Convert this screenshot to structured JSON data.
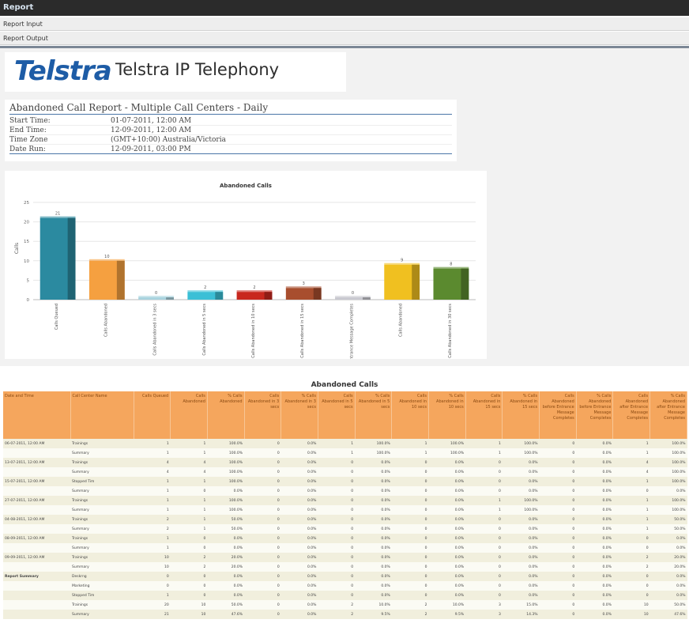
{
  "app": {
    "title": "Report"
  },
  "menu": {
    "items": [
      "Report Input",
      "Report Output"
    ]
  },
  "logo": {
    "wordmark": "Telstra",
    "product": "Telstra IP Telephony"
  },
  "report": {
    "title": "Abandoned Call Report - Multiple Call Centers - Daily",
    "fields": [
      {
        "label": "Start Time:",
        "value": "01-07-2011, 12:00 AM"
      },
      {
        "label": "End Time:",
        "value": "12-09-2011, 12:00 AM"
      },
      {
        "label": "Time Zone",
        "value": "(GMT+10:00) Australia/Victoria"
      },
      {
        "label": "Date Run:",
        "value": "12-09-2011, 03:00 PM"
      }
    ]
  },
  "chart_data": {
    "type": "bar",
    "title": "Abandoned Calls",
    "ylabel": "Calls",
    "ylim": [
      0,
      25
    ],
    "yticks": [
      0,
      5,
      10,
      15,
      20,
      25
    ],
    "grid": true,
    "categories": [
      "Calls Queued",
      "Calls Abandoned",
      "Calls Abandoned in 3 secs",
      "Calls Abandoned in 5 secs",
      "Calls Abandoned in 10 secs",
      "Calls Abandoned in 15 secs",
      "Calls Abandoned before Entrance Message Completes",
      "Calls Abandoned",
      "Calls Abandoned in 30 secs"
    ],
    "values": [
      21,
      10,
      0,
      2,
      2,
      3,
      0,
      9,
      8
    ],
    "colors": [
      "#2b8aa0",
      "#f5a040",
      "#a9d3de",
      "#3bbfd6",
      "#c8281e",
      "#a84e2e",
      "#c9c9d0",
      "#f0c020",
      "#5b8a2f"
    ]
  },
  "table": {
    "title": "Abandoned Calls",
    "columns": [
      "Date and Time",
      "Call Center Name",
      "Calls Queued",
      "Calls Abandoned",
      "% Calls Abandoned",
      "Calls Abandoned in 3 secs",
      "% Calls Abandoned in 3 secs",
      "Calls Abandoned in 5 secs",
      "% Calls Abandoned in 5 secs",
      "Calls Abandoned in 10 secs",
      "% Calls Abandoned in 10 secs",
      "Calls Abandoned in 15 secs",
      "% Calls Abandoned in 15 secs",
      "Calls Abandoned before Entrance Message Completes",
      "% Calls Abandoned before Entrance Message Completes",
      "Calls Abandoned after Entrance Message Completes",
      "% Calls Abandoned after Entrance Message Completes"
    ],
    "rows": [
      [
        "06-07-2011, 12:00 AM",
        "Trainings",
        "1",
        "1",
        "100.0%",
        "0",
        "0.0%",
        "1",
        "100.0%",
        "1",
        "100.0%",
        "1",
        "100.0%",
        "0",
        "0.0%",
        "1",
        "100.0%"
      ],
      [
        "",
        "Summary",
        "1",
        "1",
        "100.0%",
        "0",
        "0.0%",
        "1",
        "100.0%",
        "1",
        "100.0%",
        "1",
        "100.0%",
        "0",
        "0.0%",
        "1",
        "100.0%"
      ],
      [
        "13-07-2011, 12:00 AM",
        "Trainings",
        "4",
        "4",
        "100.0%",
        "0",
        "0.0%",
        "0",
        "0.0%",
        "0",
        "0.0%",
        "0",
        "0.0%",
        "0",
        "0.0%",
        "4",
        "100.0%"
      ],
      [
        "",
        "Summary",
        "4",
        "4",
        "100.0%",
        "0",
        "0.0%",
        "0",
        "0.0%",
        "0",
        "0.0%",
        "0",
        "0.0%",
        "0",
        "0.0%",
        "4",
        "100.0%"
      ],
      [
        "15-07-2011, 12:00 AM",
        "Stopped Tim",
        "1",
        "1",
        "100.0%",
        "0",
        "0.0%",
        "0",
        "0.0%",
        "0",
        "0.0%",
        "0",
        "0.0%",
        "0",
        "0.0%",
        "1",
        "100.0%"
      ],
      [
        "",
        "Summary",
        "1",
        "0",
        "0.0%",
        "0",
        "0.0%",
        "0",
        "0.0%",
        "0",
        "0.0%",
        "0",
        "0.0%",
        "0",
        "0.0%",
        "0",
        "0.0%"
      ],
      [
        "27-07-2011, 12:00 AM",
        "Trainings",
        "1",
        "1",
        "100.0%",
        "0",
        "0.0%",
        "0",
        "0.0%",
        "0",
        "0.0%",
        "1",
        "100.0%",
        "0",
        "0.0%",
        "1",
        "100.0%"
      ],
      [
        "",
        "Summary",
        "1",
        "1",
        "100.0%",
        "0",
        "0.0%",
        "0",
        "0.0%",
        "0",
        "0.0%",
        "1",
        "100.0%",
        "0",
        "0.0%",
        "1",
        "100.0%"
      ],
      [
        "04-08-2011, 12:00 AM",
        "Trainings",
        "2",
        "1",
        "50.0%",
        "0",
        "0.0%",
        "0",
        "0.0%",
        "0",
        "0.0%",
        "0",
        "0.0%",
        "0",
        "0.0%",
        "1",
        "50.0%"
      ],
      [
        "",
        "Summary",
        "2",
        "1",
        "50.0%",
        "0",
        "0.0%",
        "0",
        "0.0%",
        "0",
        "0.0%",
        "0",
        "0.0%",
        "0",
        "0.0%",
        "1",
        "50.0%"
      ],
      [
        "08-09-2011, 12:00 AM",
        "Trainings",
        "1",
        "0",
        "0.0%",
        "0",
        "0.0%",
        "0",
        "0.0%",
        "0",
        "0.0%",
        "0",
        "0.0%",
        "0",
        "0.0%",
        "0",
        "0.0%"
      ],
      [
        "",
        "Summary",
        "1",
        "0",
        "0.0%",
        "0",
        "0.0%",
        "0",
        "0.0%",
        "0",
        "0.0%",
        "0",
        "0.0%",
        "0",
        "0.0%",
        "0",
        "0.0%"
      ],
      [
        "09-09-2011, 12:00 AM",
        "Trainings",
        "10",
        "2",
        "20.0%",
        "0",
        "0.0%",
        "0",
        "0.0%",
        "0",
        "0.0%",
        "0",
        "0.0%",
        "0",
        "0.0%",
        "2",
        "20.0%"
      ],
      [
        "",
        "Summary",
        "10",
        "2",
        "20.0%",
        "0",
        "0.0%",
        "0",
        "0.0%",
        "0",
        "0.0%",
        "0",
        "0.0%",
        "0",
        "0.0%",
        "2",
        "20.0%"
      ],
      [
        "Report Summary",
        "Deskrng",
        "0",
        "0",
        "0.0%",
        "0",
        "0.0%",
        "0",
        "0.0%",
        "0",
        "0.0%",
        "0",
        "0.0%",
        "0",
        "0.0%",
        "0",
        "0.0%"
      ],
      [
        "",
        "Marketing",
        "0",
        "0",
        "0.0%",
        "0",
        "0.0%",
        "0",
        "0.0%",
        "0",
        "0.0%",
        "0",
        "0.0%",
        "0",
        "0.0%",
        "0",
        "0.0%"
      ],
      [
        "",
        "Stopped Tim",
        "1",
        "0",
        "0.0%",
        "0",
        "0.0%",
        "0",
        "0.0%",
        "0",
        "0.0%",
        "0",
        "0.0%",
        "0",
        "0.0%",
        "0",
        "0.0%"
      ],
      [
        "",
        "Trainings",
        "20",
        "10",
        "50.0%",
        "0",
        "0.0%",
        "2",
        "10.0%",
        "2",
        "10.0%",
        "3",
        "15.0%",
        "0",
        "0.0%",
        "10",
        "50.0%"
      ],
      [
        "",
        "Summary",
        "21",
        "10",
        "47.6%",
        "0",
        "0.0%",
        "2",
        "9.5%",
        "2",
        "9.5%",
        "3",
        "14.3%",
        "0",
        "0.0%",
        "10",
        "47.6%"
      ]
    ]
  }
}
